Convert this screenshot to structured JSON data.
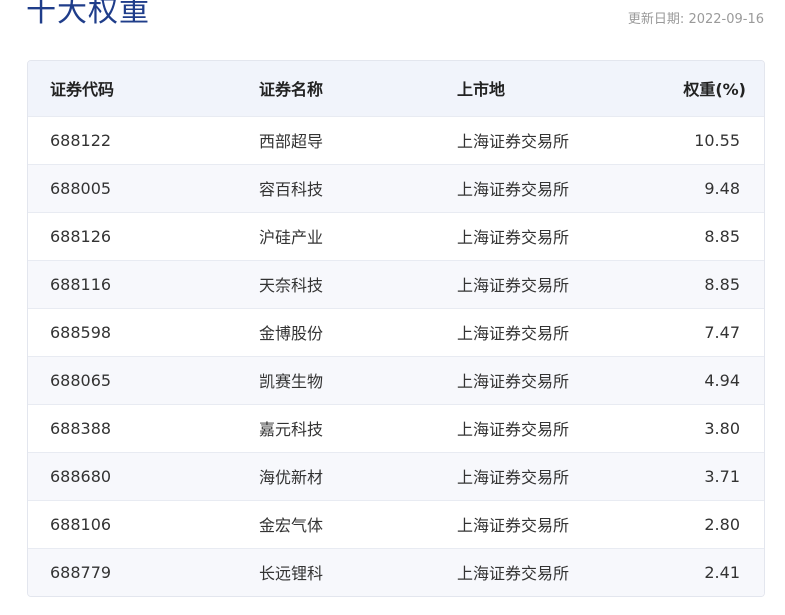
{
  "page": {
    "title": "十大权重",
    "update_label": "更新日期:",
    "update_date": "2022-09-16"
  },
  "table": {
    "headers": [
      "证券代码",
      "证券名称",
      "上市地",
      "权重(%)"
    ],
    "rows": [
      {
        "code": "688122",
        "name": "西部超导",
        "market": "上海证券交易所",
        "weight": "10.55"
      },
      {
        "code": "688005",
        "name": "容百科技",
        "market": "上海证券交易所",
        "weight": "9.48"
      },
      {
        "code": "688126",
        "name": "沪硅产业",
        "market": "上海证券交易所",
        "weight": "8.85"
      },
      {
        "code": "688116",
        "name": "天奈科技",
        "market": "上海证券交易所",
        "weight": "8.85"
      },
      {
        "code": "688598",
        "name": "金博股份",
        "market": "上海证券交易所",
        "weight": "7.47"
      },
      {
        "code": "688065",
        "name": "凯赛生物",
        "market": "上海证券交易所",
        "weight": "4.94"
      },
      {
        "code": "688388",
        "name": "嘉元科技",
        "market": "上海证券交易所",
        "weight": "3.80"
      },
      {
        "code": "688680",
        "name": "海优新材",
        "market": "上海证券交易所",
        "weight": "3.71"
      },
      {
        "code": "688106",
        "name": "金宏气体",
        "market": "上海证券交易所",
        "weight": "2.80"
      },
      {
        "code": "688779",
        "name": "长远锂科",
        "market": "上海证券交易所",
        "weight": "2.41"
      }
    ]
  },
  "colors": {
    "title": "#1f3d8a",
    "header_bg": "#f1f4fb",
    "row_alt_bg": "#f7f8fc",
    "border": "#e3e6ee",
    "muted_text": "#9a9a9a"
  }
}
